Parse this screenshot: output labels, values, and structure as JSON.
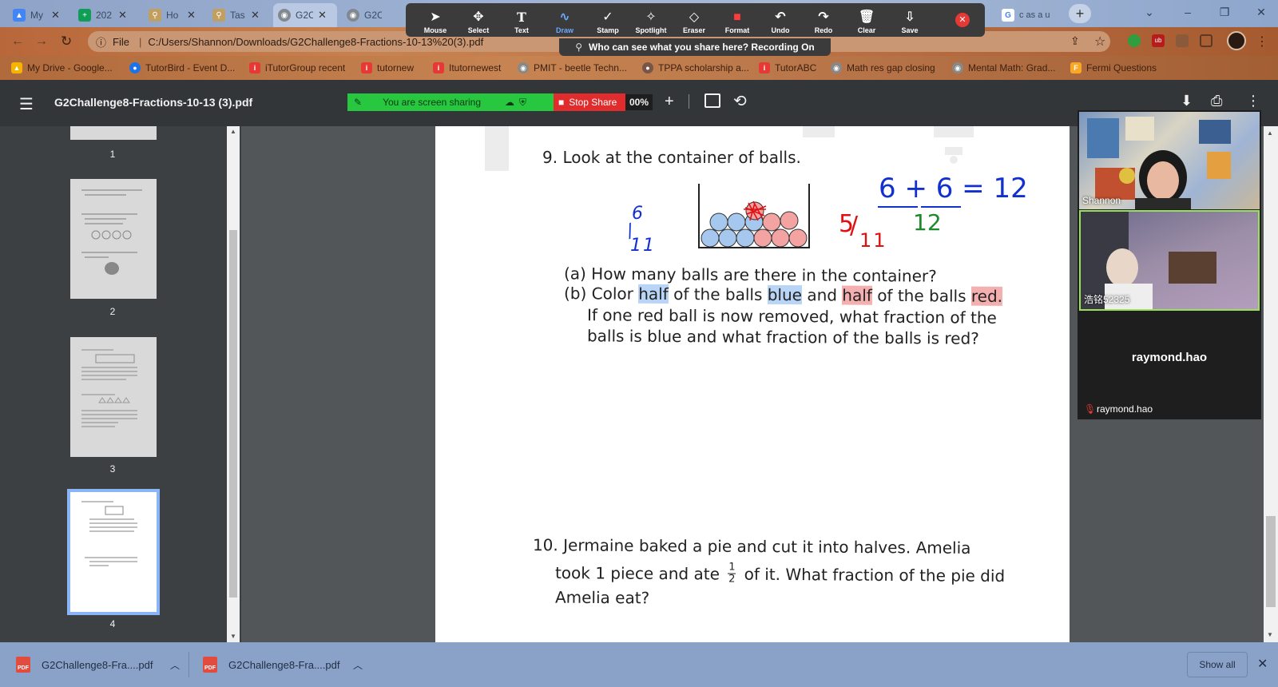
{
  "browser": {
    "tabs": [
      {
        "title": "My",
        "favicon_color": "#4285f4"
      },
      {
        "title": "202",
        "favicon_color": "#0f9d58"
      },
      {
        "title": "Ho",
        "favicon_color": "#9e9e9e"
      },
      {
        "title": "Tas",
        "favicon_color": "#9e9e9e"
      },
      {
        "title": "G2C",
        "favicon_color": "#808890"
      },
      {
        "title": "G2C",
        "favicon_color": "#808890"
      },
      {
        "title": "c as a u",
        "favicon_color": "#4285f4"
      }
    ],
    "address": {
      "prefix": "File",
      "url": "C:/Users/Shannon/Downloads/G2Challenge8-Fractions-10-13%20(3).pdf"
    },
    "bookmarks": [
      {
        "label": "My Drive - Google...",
        "icon": "drive-icon",
        "color": "#f4b400"
      },
      {
        "label": "TutorBird - Event D...",
        "icon": "tutorbird-icon",
        "color": "#1a73e8"
      },
      {
        "label": "iTutorGroup recent",
        "icon": "itutor-icon",
        "color": "#e53935"
      },
      {
        "label": "tutornew",
        "icon": "itutor-icon",
        "color": "#e53935"
      },
      {
        "label": "Itutornewest",
        "icon": "itutor-icon",
        "color": "#e53935"
      },
      {
        "label": "PMIT - beetle Techn...",
        "icon": "globe-icon",
        "color": "#888888"
      },
      {
        "label": "TPPA scholarship a...",
        "icon": "owl-icon",
        "color": "#795548"
      },
      {
        "label": "TutorABC",
        "icon": "itutor-icon",
        "color": "#e53935"
      },
      {
        "label": "Math res gap closing",
        "icon": "globe-icon",
        "color": "#888888"
      },
      {
        "label": "Mental Math: Grad...",
        "icon": "globe-icon",
        "color": "#888888"
      },
      {
        "label": "Fermi Questions",
        "icon": "fermi-icon",
        "color": "#f9a825"
      }
    ]
  },
  "zoom_toolbar": {
    "tools": [
      {
        "label": "Mouse",
        "glyph": "➤"
      },
      {
        "label": "Select",
        "glyph": "✥"
      },
      {
        "label": "Text",
        "glyph": "T"
      },
      {
        "label": "Draw",
        "glyph": "∿"
      },
      {
        "label": "Stamp",
        "glyph": "✓"
      },
      {
        "label": "Spotlight",
        "glyph": "✧"
      },
      {
        "label": "Eraser",
        "glyph": "◇"
      },
      {
        "label": "Format",
        "glyph": "■"
      },
      {
        "label": "Undo",
        "glyph": "↶"
      },
      {
        "label": "Redo",
        "glyph": "↷"
      },
      {
        "label": "Clear",
        "glyph": "🗑"
      },
      {
        "label": "Save",
        "glyph": "⇩"
      }
    ],
    "active_tool": "Draw",
    "recording_notice": "Who can see what you share here? Recording On",
    "sharing_status": "You are screen sharing",
    "stop_share": "Stop Share"
  },
  "pdf_viewer": {
    "filename": "G2Challenge8-Fractions-10-13 (3).pdf",
    "zoom": "00%",
    "thumbnails": [
      {
        "page": "1"
      },
      {
        "page": "2"
      },
      {
        "page": "3"
      },
      {
        "page": "4"
      }
    ],
    "current_page": "4"
  },
  "worksheet": {
    "q9_title": "9.  Look at the container of balls.",
    "q9_a": "(a)  How many balls are there in the container?",
    "q9_b_prefix": "(b)  Color ",
    "q9_b_half1": "half",
    "q9_b_mid1": " of the balls ",
    "q9_b_blue": "blue",
    "q9_b_mid2": " and ",
    "q9_b_half2": "half",
    "q9_b_mid3": " of the balls ",
    "q9_b_red": "red.",
    "q9_b_line2": "If one red ball is now removed, what fraction of the",
    "q9_b_line3": "balls is blue and what fraction of the balls is red?",
    "q10_line1": "10. Jermaine baked a pie and cut it into halves. Amelia",
    "q10_line2a": "took 1 piece and ate ",
    "q10_frac_num": "1",
    "q10_frac_den": "2",
    "q10_line2b": " of it. What fraction of the pie did",
    "q10_line3": "Amelia eat?",
    "annotations": {
      "blue_left_num": "6",
      "blue_left_den": "11",
      "red_num": "5",
      "red_den": "11",
      "equation_top": "6 + 6 = 12",
      "equation_bottom": "12"
    },
    "balls": {
      "blue": 6,
      "red": 5,
      "blue_color": "#a6c8ee",
      "red_color": "#f4a3a3"
    }
  },
  "video_panel": {
    "participants": [
      {
        "name": "Shannon"
      },
      {
        "name": "浩铭52325"
      },
      {
        "name": "raymond.hao",
        "tile_label": "raymond.hao"
      }
    ]
  },
  "downloads": {
    "items": [
      {
        "name": "G2Challenge8-Fra....pdf"
      },
      {
        "name": "G2Challenge8-Fra....pdf"
      }
    ],
    "show_all": "Show all"
  }
}
